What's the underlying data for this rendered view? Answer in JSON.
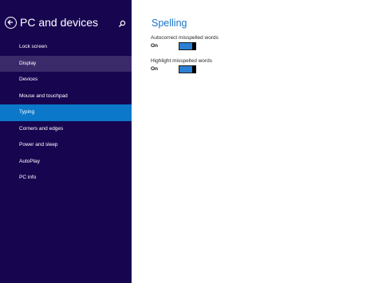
{
  "sidebar": {
    "title": "PC and devices",
    "items": [
      {
        "label": "Lock screen",
        "state": "normal"
      },
      {
        "label": "Display",
        "state": "hover"
      },
      {
        "label": "Devices",
        "state": "normal"
      },
      {
        "label": "Mouse and touchpad",
        "state": "normal"
      },
      {
        "label": "Typing",
        "state": "selected"
      },
      {
        "label": "Corners and edges",
        "state": "normal"
      },
      {
        "label": "Power and sleep",
        "state": "normal"
      },
      {
        "label": "AutoPlay",
        "state": "normal"
      },
      {
        "label": "PC info",
        "state": "normal"
      }
    ]
  },
  "main": {
    "section_title": "Spelling",
    "settings": [
      {
        "label": "Autocorrect misspelled words",
        "state": "On"
      },
      {
        "label": "Highlight misspelled words",
        "state": "On"
      }
    ]
  },
  "icons": {
    "back": "back-arrow-icon",
    "search": "search-icon"
  },
  "colors": {
    "sidebar_bg": "#170550",
    "selected_bg": "#0b78c9",
    "hover_bg": "#3a2a6a",
    "accent": "#1a74c8",
    "toggle_on": "#2b7fd4"
  }
}
